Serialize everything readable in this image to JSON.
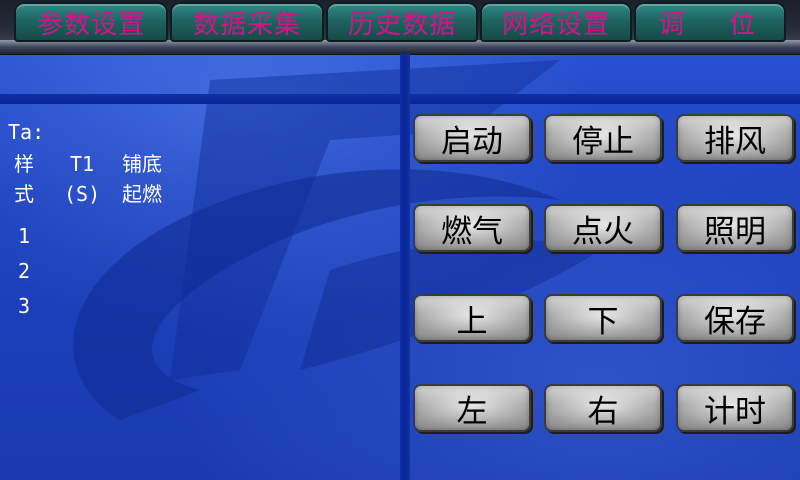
{
  "tabs": [
    {
      "label": "参数设置"
    },
    {
      "label": "数据采集"
    },
    {
      "label": "历史数据"
    },
    {
      "label": "网络设置"
    },
    {
      "label_left": "调",
      "label_right": "位"
    }
  ],
  "left_panel": {
    "ta_label": "Ta:",
    "col_sample": {
      "line1": "样",
      "line2": "式"
    },
    "col_t1": {
      "line1": "T1",
      "line2": "(S)"
    },
    "col_ignite": {
      "line1": "铺底",
      "line2": "起燃"
    },
    "rows": [
      "1",
      "2",
      "3"
    ]
  },
  "buttons": {
    "start": "启动",
    "stop": "停止",
    "exhaust": "排风",
    "gas": "燃气",
    "ignite": "点火",
    "light": "照明",
    "up": "上",
    "down": "下",
    "save": "保存",
    "left": "左",
    "right": "右",
    "timer": "计时"
  },
  "colors": {
    "tab_text": "#d2148a",
    "tab_fill": "#1f6461",
    "background": "#1d42bf",
    "button_text": "#000000"
  }
}
